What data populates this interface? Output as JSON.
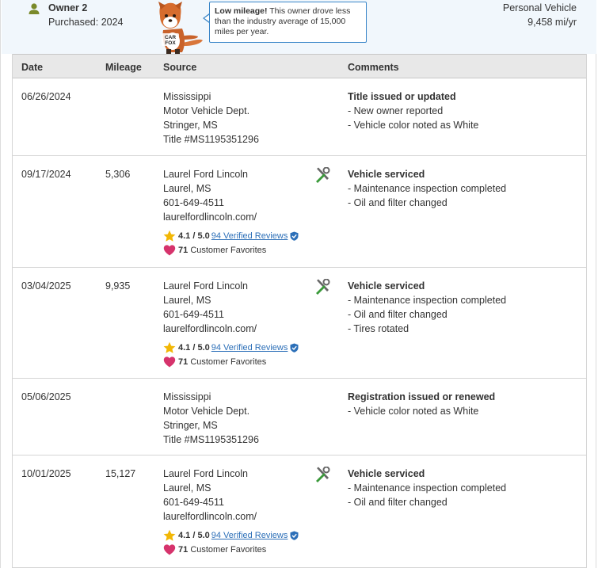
{
  "owner": {
    "title": "Owner 2",
    "purchased": "Purchased: 2024",
    "vehicle_type": "Personal Vehicle",
    "miles_per_year": "9,458 mi/yr",
    "tooltip_bold": "Low mileage!",
    "tooltip_text": " This owner drove less than the industry average of 15,000 miles per year.",
    "mascot_text": "CAR FOX"
  },
  "table": {
    "headers": {
      "date": "Date",
      "mileage": "Mileage",
      "source": "Source",
      "comments": "Comments"
    },
    "rows": [
      {
        "date": "06/26/2024",
        "mileage": "",
        "source": [
          "Mississippi",
          "Motor Vehicle Dept.",
          "Stringer, MS",
          "Title #MS1195351296"
        ],
        "comment_title": "Title issued or updated",
        "comments": [
          "- New owner reported",
          "- Vehicle color noted as White"
        ]
      },
      {
        "date": "09/17/2024",
        "mileage": "5,306",
        "source": [
          "Laurel Ford Lincoln",
          "Laurel, MS",
          "601-649-4511",
          "laurelfordlincoln.com/"
        ],
        "rating": "4.1 / 5.0",
        "reviews": "94 Verified Reviews",
        "favorites_count": "71",
        "favorites_label": "Customer Favorites",
        "comment_title": "Vehicle serviced",
        "comments": [
          "- Maintenance inspection completed",
          "- Oil and filter changed"
        ]
      },
      {
        "date": "03/04/2025",
        "mileage": "9,935",
        "source": [
          "Laurel Ford Lincoln",
          "Laurel, MS",
          "601-649-4511",
          "laurelfordlincoln.com/"
        ],
        "rating": "4.1 / 5.0",
        "reviews": "94 Verified Reviews",
        "favorites_count": "71",
        "favorites_label": "Customer Favorites",
        "comment_title": "Vehicle serviced",
        "comments": [
          "- Maintenance inspection completed",
          "- Oil and filter changed",
          "- Tires rotated"
        ]
      },
      {
        "date": "05/06/2025",
        "mileage": "",
        "source": [
          "Mississippi",
          "Motor Vehicle Dept.",
          "Stringer, MS",
          "Title #MS1195351296"
        ],
        "comment_title": "Registration issued or renewed",
        "comments": [
          "- Vehicle color noted as White"
        ]
      },
      {
        "date": "10/01/2025",
        "mileage": "15,127",
        "source": [
          "Laurel Ford Lincoln",
          "Laurel, MS",
          "601-649-4511",
          "laurelfordlincoln.com/"
        ],
        "rating": "4.1 / 5.0",
        "reviews": "94 Verified Reviews",
        "favorites_count": "71",
        "favorites_label": "Customer Favorites",
        "comment_title": "Vehicle serviced",
        "comments": [
          "- Maintenance inspection completed",
          "- Oil and filter changed"
        ]
      }
    ]
  },
  "colors": {
    "header_bg": "#f1f7fc",
    "owner_icon": "#7a8a2a",
    "link": "#2c6fb8",
    "star": "#f2b705",
    "heart": "#d6336c",
    "wrench_green": "#3a9a3a"
  },
  "icons": {
    "owner": "person-icon",
    "service": "wrench-screwdriver-icon",
    "rating": "star-icon",
    "verified": "verified-shield-icon",
    "favorites": "heart-icon"
  }
}
